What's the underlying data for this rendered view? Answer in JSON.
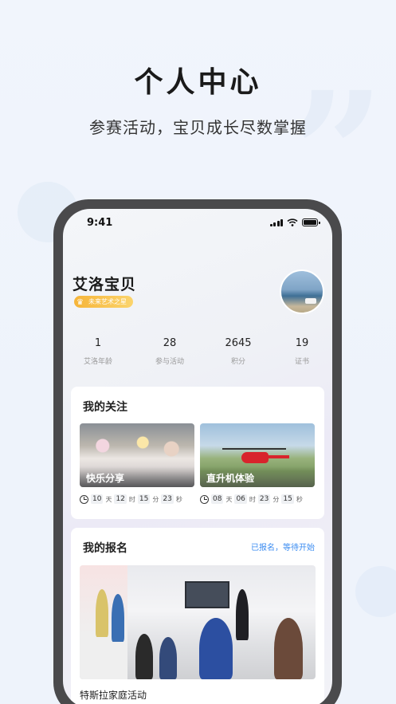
{
  "promo": {
    "headline": "个人中心",
    "subline": "参赛活动，宝贝成长尽数掌握"
  },
  "status_bar": {
    "time": "9:41"
  },
  "profile": {
    "name": "艾洛宝贝",
    "badge": "未来艺术之星"
  },
  "stats": [
    {
      "value": "1",
      "label": "艾洛年龄"
    },
    {
      "value": "28",
      "label": "参与活动"
    },
    {
      "value": "2645",
      "label": "积分"
    },
    {
      "value": "19",
      "label": "证书"
    }
  ],
  "follow": {
    "title": "我的关注",
    "items": [
      {
        "label": "快乐分享",
        "countdown": {
          "days": "10",
          "hours": "12",
          "minutes": "15",
          "seconds": "23"
        }
      },
      {
        "label": "直升机体验",
        "countdown": {
          "days": "08",
          "hours": "06",
          "minutes": "23",
          "seconds": "15"
        }
      }
    ],
    "units": {
      "day": "天",
      "hour": "时",
      "minute": "分",
      "second": "秒"
    }
  },
  "signup": {
    "title": "我的报名",
    "status": "已报名，等待开始",
    "event_name": "特斯拉家庭活动"
  },
  "colors": {
    "accent": "#3b8cf1",
    "badge": "#f6b53a",
    "phone_frame": "#4a4a4c"
  },
  "icons": [
    "signal-icon",
    "wifi-icon",
    "battery-icon",
    "clock-icon",
    "quote-decoration-icon"
  ]
}
